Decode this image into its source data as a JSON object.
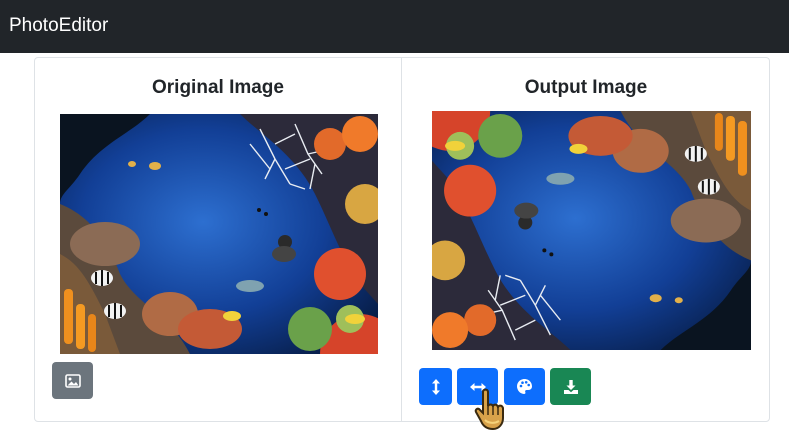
{
  "app": {
    "brand": "PhotoEditor"
  },
  "original": {
    "title": "Original Image",
    "image_alt": "Coral reef with scuba diver"
  },
  "output": {
    "title": "Output Image",
    "image_alt": "Coral reef with scuba diver (flipped horizontally and vertically)"
  },
  "buttons": {
    "select_image": {
      "icon": "image-icon"
    },
    "flip_vertical": {
      "icon": "arrows-vertical-icon"
    },
    "flip_horizontal": {
      "icon": "arrows-horizontal-icon"
    },
    "color": {
      "icon": "palette-icon"
    },
    "download": {
      "icon": "download-icon"
    }
  },
  "colors": {
    "navbar": "#212529",
    "primary": "#0d6efd",
    "secondary": "#6c757d",
    "success": "#198754"
  }
}
